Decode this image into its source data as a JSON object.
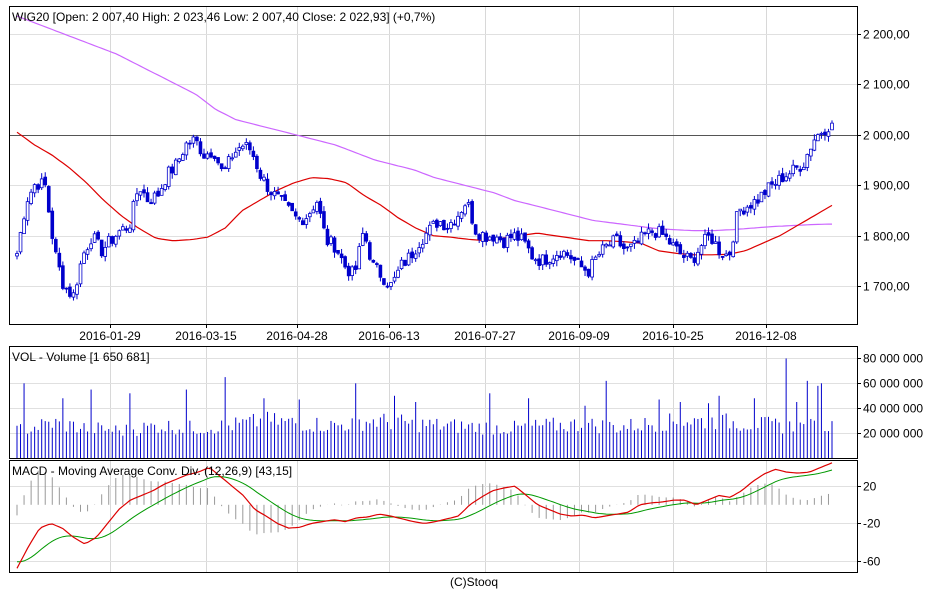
{
  "footer": "(C)Stooq",
  "chart_data": [
    {
      "type": "candlestick",
      "title": "WIG20 [Open: 2 007,40  High: 2 023,46  Low: 2 007,40  Close: 2 022,93] (+0,7%)",
      "x_tick_labels": [
        "2016-01-29",
        "2016-03-15",
        "2016-04-28",
        "2016-06-13",
        "2016-07-27",
        "2016-09-09",
        "2016-10-25",
        "2016-12-08"
      ],
      "y_tick_labels": [
        "1 700,00",
        "1 800,00",
        "1 900,00",
        "2 000,00",
        "2 100,00",
        "2 200,00"
      ],
      "y_ticks": [
        1700,
        1800,
        1900,
        2000,
        2100,
        2200
      ],
      "ylim": [
        1625,
        2255
      ],
      "reference_line": 2000,
      "x_anchor_values": [
        1765,
        1870,
        1905,
        1900,
        1770,
        1700,
        1680,
        1760,
        1800,
        1770,
        1790,
        1810,
        1820,
        1900,
        1870,
        1880,
        1920,
        1940,
        1980,
        1990,
        1960,
        1970,
        1920,
        1960,
        1980,
        1970,
        1920,
        1890,
        1870,
        1850,
        1830,
        1840,
        1870,
        1790,
        1780,
        1740,
        1720,
        1810,
        1740,
        1720,
        1700,
        1740,
        1760,
        1790,
        1810,
        1830,
        1820,
        1840,
        1870,
        1810,
        1800,
        1800,
        1790,
        1800,
        1790,
        1760,
        1750,
        1760,
        1770,
        1760,
        1740,
        1730,
        1760,
        1780,
        1790,
        1770,
        1780,
        1800,
        1810,
        1800,
        1780,
        1760,
        1750,
        1780,
        1800,
        1770,
        1760,
        1850,
        1860,
        1870,
        1890,
        1905,
        1920,
        1930,
        1945,
        1990,
        2010,
        2023
      ],
      "sma_short_values": [
        2005,
        1980,
        1960,
        1935,
        1905,
        1870,
        1840,
        1815,
        1795,
        1790,
        1792,
        1797,
        1815,
        1850,
        1870,
        1890,
        1905,
        1915,
        1913,
        1905,
        1880,
        1860,
        1835,
        1815,
        1800,
        1797,
        1793,
        1790,
        1795,
        1800,
        1805,
        1800,
        1795,
        1790,
        1790,
        1788,
        1785,
        1770,
        1765,
        1762,
        1762,
        1763,
        1770,
        1785,
        1800,
        1820,
        1840,
        1860
      ],
      "sma_long_values": [
        2235,
        2220,
        2205,
        2190,
        2175,
        2160,
        2140,
        2120,
        2100,
        2080,
        2050,
        2030,
        2020,
        2010,
        2000,
        1990,
        1980,
        1965,
        1950,
        1940,
        1930,
        1915,
        1905,
        1895,
        1885,
        1870,
        1860,
        1850,
        1840,
        1830,
        1825,
        1820,
        1815,
        1812,
        1810,
        1810,
        1812,
        1815,
        1818,
        1820,
        1822,
        1823
      ],
      "series": [
        {
          "name": "close",
          "color": "#0000cc"
        },
        {
          "color": "#dd0000"
        },
        {
          "color": "#cc66ff"
        }
      ]
    },
    {
      "type": "bar",
      "title": "VOL - Volume [1 650 681]",
      "y_tick_labels": [
        "20 000 000",
        "40 000 000",
        "60 000 000",
        "80 000 000"
      ],
      "y_ticks": [
        20000000,
        40000000,
        60000000,
        80000000
      ],
      "ylim": [
        0,
        90000000
      ],
      "series": [
        {
          "name": "Volume",
          "color": "#0000cc"
        }
      ],
      "volume_envelope": [
        22000000,
        28000000,
        24000000,
        22000000,
        26000000,
        24000000,
        26000000,
        30000000,
        28000000,
        26000000,
        30000000,
        28000000,
        26000000,
        25000000,
        24000000,
        26000000,
        27000000,
        25000000,
        28000000,
        30000000,
        29000000,
        27000000,
        25000000,
        26000000
      ],
      "volume_spikes": [
        [
          3,
          58000000
        ],
        [
          4,
          60000000
        ],
        [
          24,
          48000000
        ],
        [
          40,
          55000000
        ],
        [
          60,
          52000000
        ],
        [
          90,
          55000000
        ],
        [
          110,
          65000000
        ],
        [
          130,
          48000000
        ],
        [
          150,
          47000000
        ],
        [
          180,
          60000000
        ],
        [
          200,
          50000000
        ],
        [
          210,
          45000000
        ],
        [
          250,
          52000000
        ],
        [
          270,
          48000000
        ],
        [
          300,
          42000000
        ],
        [
          312,
          62000000
        ],
        [
          340,
          47000000
        ],
        [
          350,
          45000000
        ],
        [
          365,
          44000000
        ],
        [
          372,
          50000000
        ],
        [
          390,
          48000000
        ],
        [
          407,
          80000000
        ],
        [
          412,
          45000000
        ],
        [
          418,
          62000000
        ],
        [
          423,
          58000000
        ],
        [
          426,
          60000000
        ]
      ]
    },
    {
      "type": "line",
      "title": "MACD - Moving Average Conv. Div. (12,26,9) [43,15]",
      "y_tick_labels": [
        "-60",
        "-20",
        "20"
      ],
      "y_ticks": [
        -60,
        -20,
        20
      ],
      "ylim": [
        -72,
        48
      ],
      "series": [
        {
          "name": "MACD",
          "color": "#dd0000",
          "values": [
            -68,
            -45,
            -25,
            -20,
            -25,
            -35,
            -42,
            -35,
            -20,
            -5,
            5,
            10,
            15,
            22,
            27,
            32,
            35,
            40,
            30,
            20,
            10,
            -5,
            -12,
            -20,
            -25,
            -24,
            -20,
            -18,
            -16,
            -18,
            -14,
            -13,
            -10,
            -12,
            -15,
            -18,
            -20,
            -18,
            -15,
            -12,
            0,
            8,
            15,
            18,
            20,
            10,
            0,
            -5,
            -10,
            -12,
            -11,
            -14,
            -12,
            -10,
            -8,
            0,
            2,
            3,
            5,
            5,
            0,
            5,
            10,
            8,
            15,
            25,
            33,
            38,
            35,
            34,
            35,
            40,
            45
          ]
        },
        {
          "name": "Signal",
          "color": "#009900"
        },
        {
          "name": "Histogram",
          "color": "#999999"
        }
      ]
    }
  ]
}
